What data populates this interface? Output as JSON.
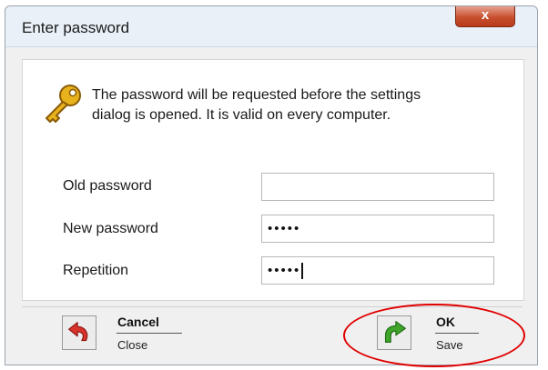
{
  "dialog": {
    "title": "Enter password",
    "close_glyph": "x",
    "info_line1": "The password will be requested before the settings",
    "info_line2": "dialog is opened. It is valid on every computer."
  },
  "fields": {
    "old_label": "Old password",
    "old_value": "",
    "new_label": "New password",
    "new_value": "•••••",
    "rep_label": "Repetition",
    "rep_value": "•••••"
  },
  "actions": {
    "cancel_title": "Cancel",
    "cancel_sub": "Close",
    "ok_title": "OK",
    "ok_sub": "Save"
  },
  "icons": {
    "title_icon": "key-icon",
    "cancel_icon": "undo-arrow-icon",
    "ok_icon": "green-arrow-icon"
  },
  "colors": {
    "highlight": "#e00000",
    "ok_green": "#3ea52a",
    "cancel_red": "#d7332b",
    "key_gold": "#e7b21b"
  }
}
